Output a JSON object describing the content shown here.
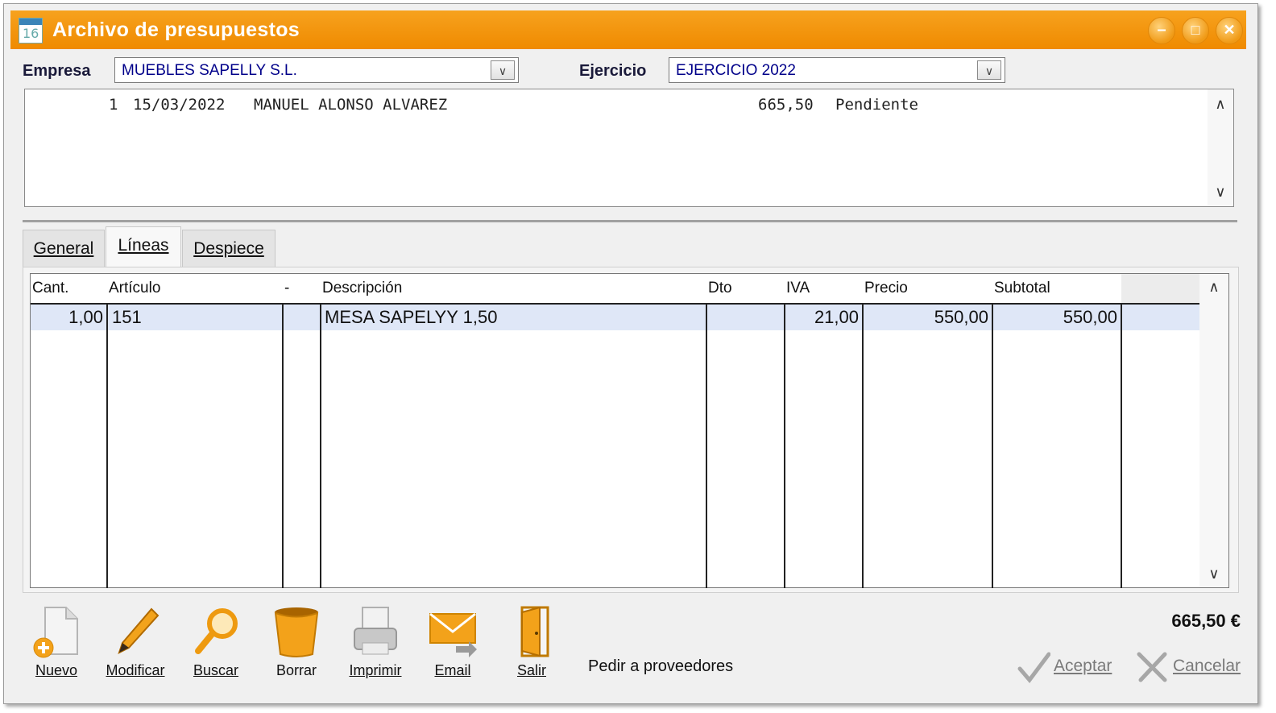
{
  "window": {
    "title": "Archivo de presupuestos",
    "title_icon_number": "16",
    "accent_color": "#f29100"
  },
  "controls": {
    "minimize": "–",
    "maximize": "□",
    "close": "✕"
  },
  "filters": {
    "empresa_label": "Empresa",
    "empresa_value": "MUEBLES SAPELLY S.L.",
    "ejercicio_label": "Ejercicio",
    "ejercicio_value": "EJERCICIO 2022"
  },
  "budgets_list": [
    {
      "number": "1",
      "date": "15/03/2022",
      "client": "MANUEL ALONSO ALVAREZ",
      "amount": "665,50",
      "status": "Pendiente"
    }
  ],
  "tabs": [
    {
      "label": "General",
      "active": false
    },
    {
      "label": "Líneas",
      "active": true
    },
    {
      "label": "Despiece",
      "active": false
    }
  ],
  "lines_table": {
    "columns": [
      "Cant.",
      "Artículo",
      "-",
      "Descripción",
      "Dto",
      "IVA",
      "Precio",
      "Subtotal"
    ],
    "rows": [
      {
        "cant": "1,00",
        "articulo": "151",
        "dash": "",
        "descripcion": "MESA SAPELYY 1,50",
        "dto": "",
        "iva": "21,00",
        "precio": "550,00",
        "subtotal": "550,00"
      }
    ]
  },
  "toolbar": {
    "nuevo": "Nuevo",
    "modificar": "Modificar",
    "buscar": "Buscar",
    "borrar": "Borrar",
    "imprimir": "Imprimir",
    "email": "Email",
    "salir": "Salir",
    "pedir": "Pedir a proveedores"
  },
  "total": "665,50 €",
  "actions": {
    "aceptar": "Aceptar",
    "cancelar": "Cancelar"
  }
}
